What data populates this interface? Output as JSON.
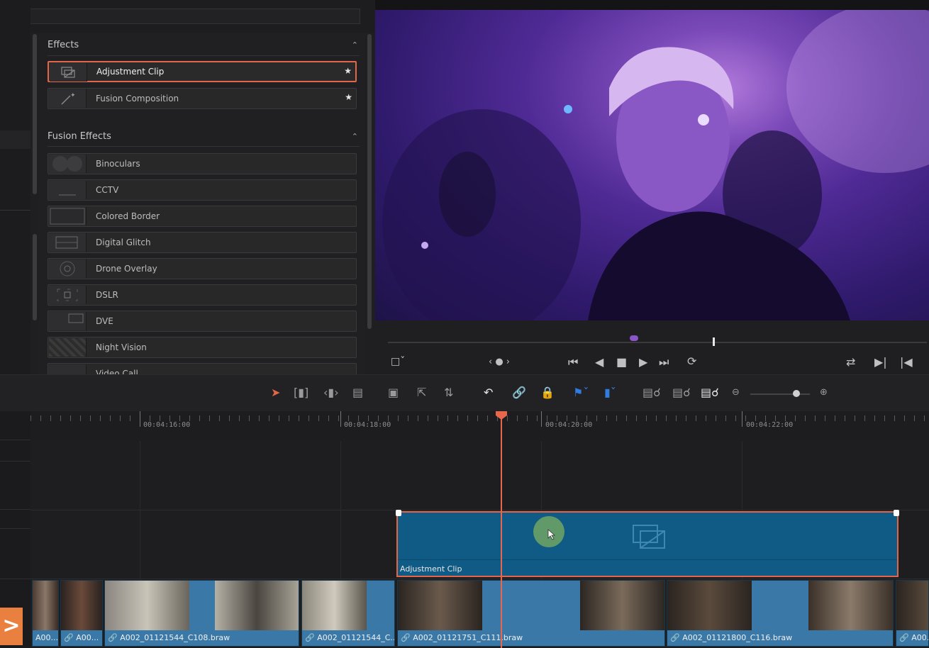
{
  "effects": {
    "section_title": "Effects",
    "items": [
      {
        "label": "Adjustment Clip",
        "icon": "adjustment-clip-icon",
        "favorite": true
      },
      {
        "label": "Fusion Composition",
        "icon": "fusion-wand-icon",
        "favorite": true
      }
    ]
  },
  "fusion_effects": {
    "section_title": "Fusion Effects",
    "items": [
      {
        "label": "Binoculars"
      },
      {
        "label": "CCTV"
      },
      {
        "label": "Colored Border"
      },
      {
        "label": "Digital Glitch"
      },
      {
        "label": "Drone Overlay"
      },
      {
        "label": "DSLR"
      },
      {
        "label": "DVE"
      },
      {
        "label": "Night Vision"
      },
      {
        "label": "Video Call"
      }
    ]
  },
  "ruler": {
    "timecodes": [
      "00:04:16:00",
      "00:04:18:00",
      "00:04:20:00",
      "00:04:22:00"
    ]
  },
  "timeline": {
    "adjustment_clip_label": "Adjustment Clip",
    "video_clips": [
      "A00...",
      "A00...",
      "A002_01121544_C108.braw",
      "A002_01121544_C...",
      "A002_01121751_C111.braw",
      "A002_01121800_C116.braw",
      "A00..."
    ]
  },
  "colors": {
    "accent": "#e2664a",
    "clip_blue": "#0f5b85",
    "video_clip": "#3a78a8"
  }
}
